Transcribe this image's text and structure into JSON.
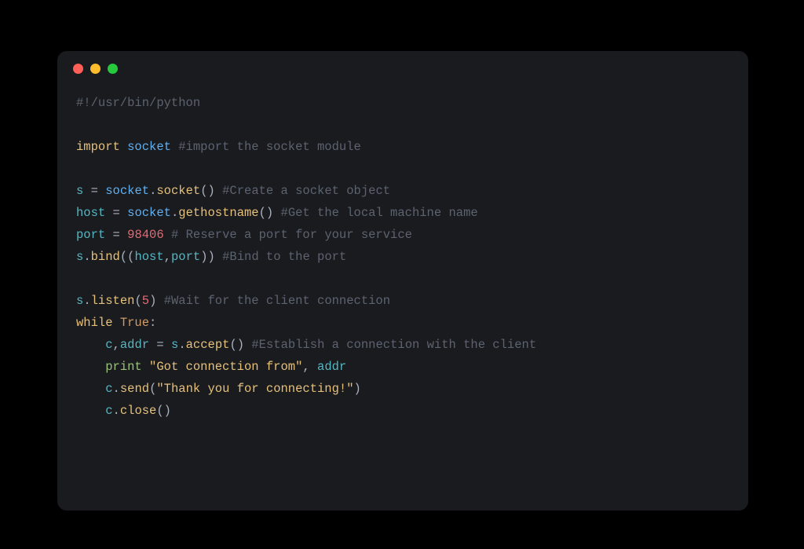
{
  "window": {
    "buttons": [
      "close",
      "minimize",
      "zoom"
    ]
  },
  "code": {
    "l1": {
      "shebang": "#!/usr/bin/python"
    },
    "l2": {
      "import": "import",
      "sp": " ",
      "mod": "socket",
      "sp2": " ",
      "comment": "#import the socket module"
    },
    "l3": {
      "v": "s",
      "sp": " ",
      "eq": "=",
      "sp2": " ",
      "m": "socket",
      "dot": ".",
      "fn": "socket",
      "p": "()",
      "sp3": " ",
      "comment": "#Create a socket object"
    },
    "l4": {
      "v": "host",
      "sp": " ",
      "eq": "=",
      "sp2": " ",
      "m": "socket",
      "dot": ".",
      "fn": "gethostname",
      "p": "()",
      "sp3": " ",
      "comment": "#Get the local machine name"
    },
    "l5": {
      "v": "port",
      "sp": " ",
      "eq": "=",
      "sp2": " ",
      "num": "98406",
      "sp3": " ",
      "comment": "# Reserve a port for your service"
    },
    "l6": {
      "v": "s",
      "dot": ".",
      "fn": "bind",
      "po": "((",
      "a1": "host",
      "comma": ",",
      "a2": "port",
      "pc": "))",
      "sp": " ",
      "comment": "#Bind to the port"
    },
    "l7": {
      "v": "s",
      "dot": ".",
      "fn": "listen",
      "po": "(",
      "num": "5",
      "pc": ")",
      "sp": " ",
      "comment": "#Wait for the client connection"
    },
    "l8": {
      "while": "while",
      "sp": " ",
      "true": "True",
      "colon": ":"
    },
    "l9": {
      "indent": "    ",
      "v1": "c",
      "comma": ",",
      "v2": "addr",
      "sp": " ",
      "eq": "=",
      "sp2": " ",
      "v3": "s",
      "dot": ".",
      "fn": "accept",
      "p": "()",
      "sp3": " ",
      "comment": "#Establish a connection with the client"
    },
    "l10": {
      "indent": "    ",
      "print": "print",
      "sp": " ",
      "str": "\"Got connection from\"",
      "comma": ",",
      "sp2": " ",
      "v": "addr"
    },
    "l11": {
      "indent": "    ",
      "v": "c",
      "dot": ".",
      "fn": "send",
      "po": "(",
      "str": "\"Thank you for connecting!\"",
      "pc": ")"
    },
    "l12": {
      "indent": "    ",
      "v": "c",
      "dot": ".",
      "fn": "close",
      "p": "()"
    }
  }
}
